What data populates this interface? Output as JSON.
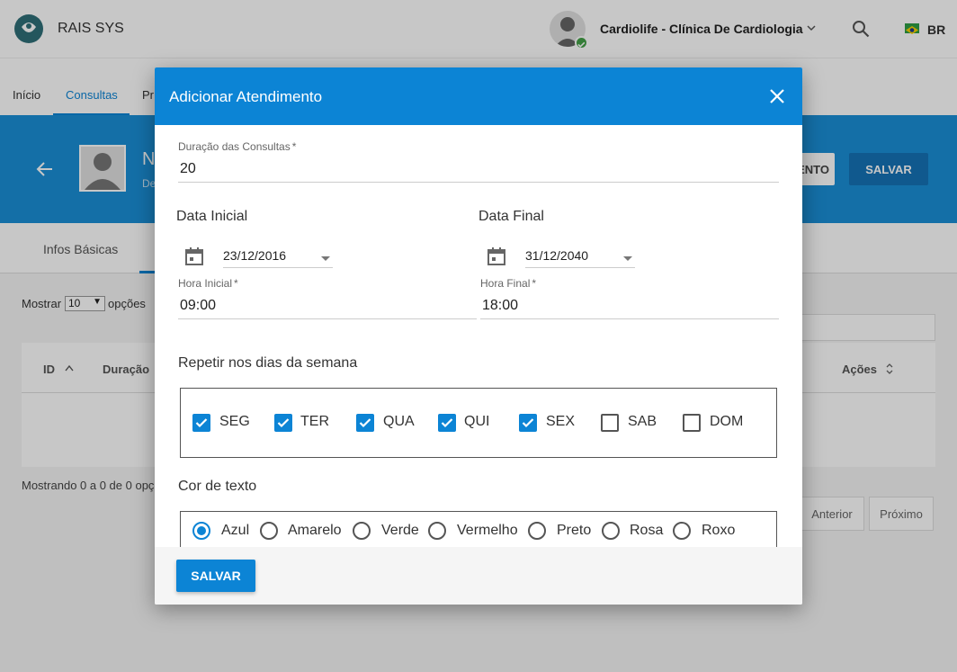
{
  "app": {
    "title": "RAIS SYS"
  },
  "header": {
    "clinic": "Cardiolife - Clínica De Cardiologia",
    "language": "BR"
  },
  "nav": {
    "items": [
      "Início",
      "Consultas",
      "Pr"
    ]
  },
  "banner": {
    "title": "N",
    "subtitle": "De",
    "appointment_button": "ENTO",
    "save_button": "SALVAR"
  },
  "tabs": {
    "basic_info": "Infos Básicas"
  },
  "table": {
    "show_label": "Mostrar",
    "show_value": "10",
    "options_label": "opções",
    "columns": [
      "ID",
      "Duração",
      "Ações"
    ],
    "showing_text": "Mostrando 0 a 0 de 0 opçõ",
    "prev": "Anterior",
    "next": "Próximo"
  },
  "dialog": {
    "title": "Adicionar Atendimento",
    "duration": {
      "label": "Duração das Consultas",
      "required_mark": "*",
      "value": "20"
    },
    "start_date": {
      "title": "Data Inicial",
      "value": "23/12/2016"
    },
    "end_date": {
      "title": "Data Final",
      "value": "31/12/2040"
    },
    "start_time": {
      "label": "Hora Inicial",
      "required_mark": "*",
      "value": "09:00"
    },
    "end_time": {
      "label": "Hora Final",
      "required_mark": "*",
      "value": "18:00"
    },
    "weekdays": {
      "title": "Repetir nos dias da semana",
      "days": [
        {
          "label": "SEG",
          "checked": true
        },
        {
          "label": "TER",
          "checked": true
        },
        {
          "label": "QUA",
          "checked": true
        },
        {
          "label": "QUI",
          "checked": true
        },
        {
          "label": "SEX",
          "checked": true
        },
        {
          "label": "SAB",
          "checked": false
        },
        {
          "label": "DOM",
          "checked": false
        }
      ]
    },
    "text_color": {
      "title": "Cor de texto",
      "options": [
        {
          "label": "Azul",
          "selected": true
        },
        {
          "label": "Amarelo",
          "selected": false
        },
        {
          "label": "Verde",
          "selected": false
        },
        {
          "label": "Vermelho",
          "selected": false
        },
        {
          "label": "Preto",
          "selected": false
        },
        {
          "label": "Rosa",
          "selected": false
        },
        {
          "label": "Roxo",
          "selected": false
        }
      ]
    },
    "save_button": "SALVAR"
  },
  "colors": {
    "primary": "#0c84d5",
    "banner": "#1a8fd6",
    "check_green": "#43a047"
  }
}
